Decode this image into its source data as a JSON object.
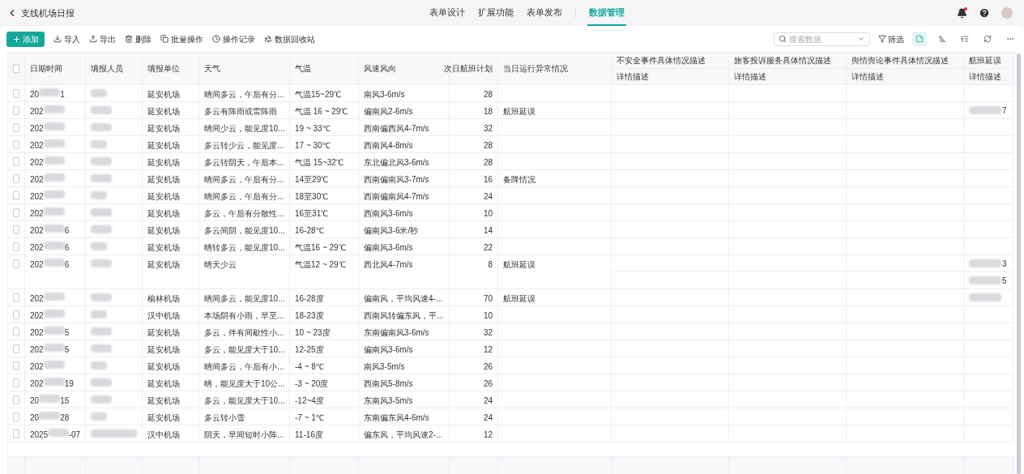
{
  "title": "支线机场日报",
  "nav_tabs": [
    {
      "label": "表单设计",
      "selected": false
    },
    {
      "label": "扩展功能",
      "selected": false
    },
    {
      "label": "表单发布",
      "selected": false
    },
    {
      "label": "数据管理",
      "selected": true
    }
  ],
  "notifications": {
    "unread": true
  },
  "toolbar": {
    "add": "添加",
    "actions": [
      {
        "kind": "import",
        "label": "导入"
      },
      {
        "kind": "export",
        "label": "导出"
      },
      {
        "kind": "delete",
        "label": "删除"
      },
      {
        "kind": "batch",
        "label": "批量操作"
      },
      {
        "kind": "log",
        "label": "操作记录"
      },
      {
        "kind": "recycle",
        "label": "数据回收站"
      }
    ]
  },
  "search": {
    "placeholder": "搜索数据"
  },
  "filter": "筛选",
  "view_buttons": [
    {
      "kind": "card",
      "selected": true
    },
    {
      "kind": "sort",
      "selected": false
    },
    {
      "kind": "list",
      "selected": false
    },
    {
      "kind": "refresh",
      "selected": false
    },
    {
      "kind": "more",
      "selected": false
    }
  ],
  "table": {
    "all_checked": false,
    "columns": [
      "日期时间",
      "填报人员",
      "填报单位",
      "天气",
      "气温",
      "风速风向",
      "次日航班计划",
      "当日运行异常情况"
    ],
    "detail_columns": [
      {
        "title": "不安全事件具体情况描述",
        "subtitle": "详情描述"
      },
      {
        "title": "旅客投诉服务具体情况描述",
        "subtitle": "详情描述"
      },
      {
        "title": "舆情舆论事件具体情况描述",
        "subtitle": "详情描述"
      },
      {
        "title": "航班延误",
        "subtitle": "详情描述"
      }
    ],
    "rows": [
      {
        "checked": false,
        "date": [
          "20",
          "1"
        ],
        "unit": "延安机场",
        "weather": "晴间多云，午后有分...",
        "temperature": "气温15~29℃",
        "wind": "南风3-6m/s",
        "flights": "28"
      },
      {
        "checked": false,
        "date": [
          "202"
        ],
        "unit": "延安机场",
        "weather": "多云有阵雨或雷阵雨",
        "temperature": "气温 16 ~ 29℃",
        "wind": "偏南风2-6m/s",
        "flights": "18",
        "anomaly": "航班延误",
        "details": [
          {
            "redacted": true,
            "tail": "7"
          }
        ]
      },
      {
        "checked": false,
        "date": [
          "202"
        ],
        "unit": "延安机场",
        "weather": "晴间少云，能见度10...",
        "temperature": "19 ~ 33℃",
        "wind": "西南偏西风4-7m/s",
        "flights": "32"
      },
      {
        "checked": false,
        "date": [
          "202"
        ],
        "unit": "延安机场",
        "weather": "多云转少云，能见度...",
        "temperature": "17 ~ 30℃",
        "wind": "西南风4-8m/s",
        "flights": "28"
      },
      {
        "checked": false,
        "date": [
          "202"
        ],
        "unit": "延安机场",
        "weather": "多云转阴天，午后本...",
        "temperature": "气温 15~32℃",
        "wind": "东北偏北风3-6m/s",
        "flights": "28"
      },
      {
        "checked": false,
        "date": [
          "202"
        ],
        "unit": "延安机场",
        "weather": "晴间多云，午后有分...",
        "temperature": "14至29℃",
        "wind": "西南偏南风3-7m/s",
        "flights": "16",
        "anomaly": "备降情况"
      },
      {
        "checked": false,
        "date": [
          "202"
        ],
        "unit": "延安机场",
        "weather": "晴间多云，午后有分...",
        "temperature": "18至30℃",
        "wind": "西南偏南风4-7m/s",
        "flights": "24"
      },
      {
        "checked": false,
        "date": [
          "202"
        ],
        "unit": "延安机场",
        "weather": "多云，午后有分散性...",
        "temperature": "16至31℃",
        "wind": "西南风3-6m/s",
        "flights": "10"
      },
      {
        "checked": false,
        "date": [
          "202",
          "6"
        ],
        "unit": "延安机场",
        "weather": "多云间阴，能见度10...",
        "temperature": "16-28℃",
        "wind": "偏南风3-6米/秒",
        "flights": "14"
      },
      {
        "checked": false,
        "date": [
          "202",
          "6"
        ],
        "unit": "延安机场",
        "weather": "晴转多云，能见度10...",
        "temperature": "气温16 ~ 29℃",
        "wind": "偏南风3-6m/s",
        "flights": "22"
      },
      {
        "checked": false,
        "date": [
          "202",
          "6"
        ],
        "unit": "延安机场",
        "weather": "晴天少云",
        "temperature": "气温12 ~ 29℃",
        "wind": "西北风4-7m/s",
        "flights": "8",
        "anomaly": "航班延误",
        "details": [
          {
            "redacted": true,
            "tail": "3"
          },
          {
            "redacted": true,
            "tail": "5"
          }
        ]
      },
      {
        "checked": false,
        "date": [
          "202"
        ],
        "unit": "榆林机场",
        "weather": "晴间多云，能见度10...",
        "temperature": "16-28度",
        "wind": "偏南风，平均风速4-...",
        "flights": "70",
        "anomaly": "航班延误",
        "details": [
          {
            "redacted": true
          }
        ]
      },
      {
        "checked": false,
        "date": [
          "202"
        ],
        "unit": "汉中机场",
        "weather": "本场阴有小雨，早至...",
        "temperature": "18-23度",
        "wind": "西南风转偏东风，平...",
        "flights": "10"
      },
      {
        "checked": false,
        "date": [
          "202",
          "5"
        ],
        "unit": "延安机场",
        "weather": "多云，伴有间歇性小...",
        "temperature": "10 ~ 23度",
        "wind": "东南偏南风3-6m/s",
        "flights": "32"
      },
      {
        "checked": false,
        "date": [
          "202",
          "5"
        ],
        "unit": "延安机场",
        "weather": "多云，能见度大于10...",
        "temperature": "12-25度",
        "wind": "偏南风3-6m/s",
        "flights": "12"
      },
      {
        "checked": false,
        "date": [
          "202"
        ],
        "unit": "延安机场",
        "weather": "晴间多云，午后有小...",
        "temperature": "-4 ~ 8℃",
        "wind": "南风3-5m/s",
        "flights": "26"
      },
      {
        "checked": false,
        "date": [
          "202",
          "19"
        ],
        "unit": "延安机场",
        "weather": "晴，能见度大于10公...",
        "temperature": "-3 ~ 20度",
        "wind": "西南风5-8m/s",
        "flights": "26"
      },
      {
        "checked": false,
        "date": [
          "20",
          "15"
        ],
        "unit": "延安机场",
        "weather": "多云，能见度大于10...",
        "temperature": "-12~4度",
        "wind": "东南风3-5m/s",
        "flights": "24"
      },
      {
        "checked": false,
        "date": [
          "20",
          "28"
        ],
        "unit": "延安机场",
        "weather": "多云转小雪",
        "temperature": "-7 ~ 1℃",
        "wind": "东南偏东风4-6m/s",
        "flights": "24"
      },
      {
        "checked": false,
        "date": [
          "2025",
          "-07"
        ],
        "unit": "汉中机场",
        "weather": "阴天，早间短时小阵...",
        "temperature": "11-16度",
        "wind": "偏东风，平均风速2-...",
        "flights": "12"
      }
    ]
  }
}
